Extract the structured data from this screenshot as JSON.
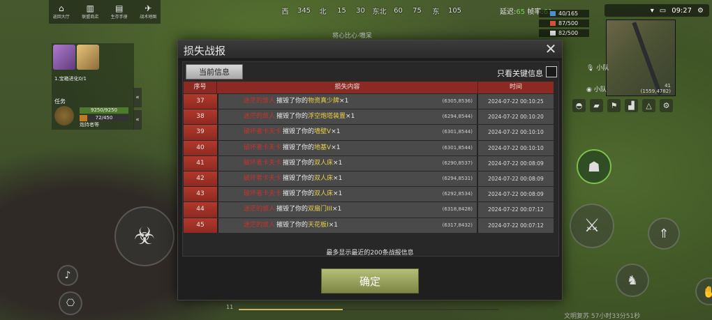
{
  "hud": {
    "top_buttons": [
      {
        "label": "返回大厅",
        "icon": "home-icon"
      },
      {
        "label": "联盟商店",
        "icon": "shop-icon"
      },
      {
        "label": "生存手册",
        "icon": "book-icon"
      },
      {
        "label": "战术地图",
        "icon": "map-icon"
      }
    ],
    "compass": [
      "西",
      "345",
      "北",
      "15",
      "30",
      "东北",
      "60",
      "75",
      "东",
      "105"
    ],
    "stats_label_1": "延迟:",
    "stats_value_1": "65",
    "stats_label_2": "帧率:",
    "stats_value_2": "61",
    "resources": [
      {
        "value": "40/165",
        "color": "#4a90d9"
      },
      {
        "value": "87/500",
        "color": "#d9503f"
      },
      {
        "value": "82/500",
        "color": "#e8e8e8"
      }
    ],
    "clock": "09:27",
    "minimap": {
      "coord_line1": "41",
      "coord_line2": "(1559,4782)"
    },
    "map_side": [
      "小队",
      "小队"
    ],
    "player_tag": "将心比心·嗷呆",
    "left_panel": {
      "task_title": "1.宝箱进化0/1",
      "task_label": "任务",
      "bar1": "9250/9250",
      "bar2": "72/450",
      "task_sub": "炮持者等"
    },
    "level_text": "11",
    "bottom_right_text": "文明复苏 57小时33分51秒"
  },
  "dialog": {
    "title": "损失战报",
    "close_icon": "close-icon",
    "tab_current": "当前信息",
    "key_only_label": "只看关键信息",
    "key_only_checked": false,
    "columns": [
      "序号",
      "损失内容",
      "时间"
    ],
    "rows": [
      {
        "no": "37",
        "attacker": "迷茫的旅人",
        "verb": "摧毁了你的",
        "item": "物资真少牌",
        "count": "×1",
        "pos": "(6305,8536)",
        "time": "2024-07-22 00:10:25"
      },
      {
        "no": "38",
        "attacker": "迷茫的旅人",
        "verb": "摧毁了你的",
        "item": "浮空炮塔装置",
        "count": "×1",
        "pos": "(6294,8544)",
        "time": "2024-07-22 00:10:20"
      },
      {
        "no": "39",
        "attacker": "破坏者卡夫卡",
        "verb": "摧毁了你的",
        "item": "墙壁V",
        "count": "×1",
        "pos": "(6301,8544)",
        "time": "2024-07-22 00:10:10"
      },
      {
        "no": "40",
        "attacker": "破坏者卡夫卡",
        "verb": "摧毁了你的",
        "item": "地基V",
        "count": "×1",
        "pos": "(6301,8544)",
        "time": "2024-07-22 00:10:10"
      },
      {
        "no": "41",
        "attacker": "破坏者卡夫卡",
        "verb": "摧毁了你的",
        "item": "双人床",
        "count": "×1",
        "pos": "(6290,8537)",
        "time": "2024-07-22 00:08:09"
      },
      {
        "no": "42",
        "attacker": "破坏者卡夫卡",
        "verb": "摧毁了你的",
        "item": "双人床",
        "count": "×1",
        "pos": "(6294,8531)",
        "time": "2024-07-22 00:08:09"
      },
      {
        "no": "43",
        "attacker": "破坏者卡夫卡",
        "verb": "摧毁了你的",
        "item": "双人床",
        "count": "×1",
        "pos": "(6292,8534)",
        "time": "2024-07-22 00:08:09"
      },
      {
        "no": "44",
        "attacker": "迷茫的旅人",
        "verb": "摧毁了你的",
        "item": "双扇门III",
        "count": "×1",
        "pos": "(6318,8428)",
        "time": "2024-07-22 00:07:12"
      },
      {
        "no": "45",
        "attacker": "迷茫的旅人",
        "verb": "摧毁了你的",
        "item": "天花板I",
        "count": "×1",
        "pos": "(6317,8432)",
        "time": "2024-07-22 00:07:12"
      }
    ],
    "footer_note": "最多显示最近的200条战报信息",
    "confirm_label": "确定"
  }
}
